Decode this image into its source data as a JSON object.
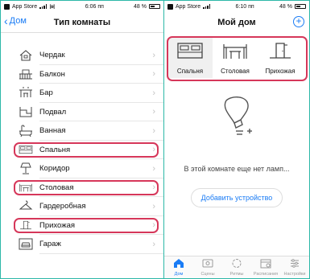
{
  "left_screen": {
    "status": {
      "carrier": "App Store",
      "time": "6:06 пп",
      "battery": "48 %"
    },
    "nav": {
      "back": "Дом",
      "title": "Тип комнаты"
    },
    "rooms": [
      {
        "label": "Чердак",
        "icon": "attic-icon",
        "highlighted": false
      },
      {
        "label": "Балкон",
        "icon": "balcony-icon",
        "highlighted": false
      },
      {
        "label": "Бар",
        "icon": "bar-icon",
        "highlighted": false
      },
      {
        "label": "Подвал",
        "icon": "basement-icon",
        "highlighted": false
      },
      {
        "label": "Ванная",
        "icon": "bathtub-icon",
        "highlighted": false
      },
      {
        "label": "Спальня",
        "icon": "bed-icon",
        "highlighted": true
      },
      {
        "label": "Коридор",
        "icon": "lamp-icon",
        "highlighted": false
      },
      {
        "label": "Столовая",
        "icon": "dining-table-icon",
        "highlighted": true
      },
      {
        "label": "Гардеробная",
        "icon": "wardrobe-icon",
        "highlighted": false
      },
      {
        "label": "Прихожая",
        "icon": "hallway-icon",
        "highlighted": true
      },
      {
        "label": "Гараж",
        "icon": "car-icon",
        "highlighted": false
      }
    ]
  },
  "right_screen": {
    "status": {
      "carrier": "App Store",
      "time": "6:10 пп",
      "battery": "48 %"
    },
    "nav": {
      "title": "Мой дом"
    },
    "room_tabs": [
      {
        "label": "Спальня",
        "icon": "bed-icon",
        "active": true
      },
      {
        "label": "Столовая",
        "icon": "dining-table-icon",
        "active": false
      },
      {
        "label": "Прихожая",
        "icon": "hallway-icon",
        "active": false
      }
    ],
    "empty_message": "В этой комнате еще нет ламп...",
    "add_device_label": "Добавить устройство",
    "tabbar": [
      {
        "label": "Дом",
        "icon": "home-icon",
        "active": true
      },
      {
        "label": "Сцены",
        "icon": "scenes-icon",
        "active": false
      },
      {
        "label": "Ритмы",
        "icon": "rhythm-icon",
        "active": false
      },
      {
        "label": "Расписания",
        "icon": "schedule-icon",
        "active": false
      },
      {
        "label": "Настройки",
        "icon": "settings-icon",
        "active": false
      }
    ]
  },
  "colors": {
    "accent": "#1a7cf5",
    "highlight": "#d6375a",
    "frame": "#2db8a8"
  }
}
